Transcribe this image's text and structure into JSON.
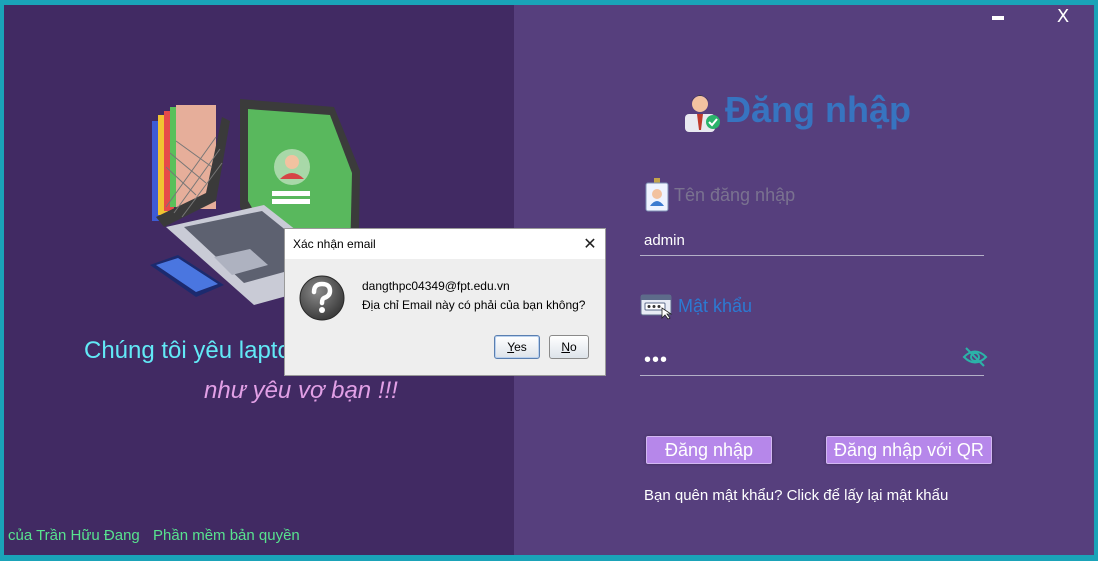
{
  "window": {
    "minimize_label": "",
    "close_label": "X"
  },
  "left": {
    "slogan_line1": "Chúng tôi yêu laptop",
    "slogan_line2": "như yêu vợ bạn !!!",
    "footer_author": "của Trần Hữu Đang",
    "footer_copyright": "Phần mềm bản quyền"
  },
  "login": {
    "title": "Đăng nhập",
    "username_label": "Tên đăng nhập",
    "username_value": "admin",
    "password_label": "Mật khẩu",
    "password_value": "•••",
    "login_button": "Đăng nhập",
    "qr_button": "Đăng nhập với QR",
    "forgot_link": "Bạn quên mật khẩu? Click để lấy lại mật khẩu"
  },
  "dialog": {
    "title": "Xác nhận email",
    "close_label": "✕",
    "email": "dangthpc04349@fpt.edu.vn",
    "question": "Địa chỉ Email này có phải của bạn không?",
    "yes_label": "Yes",
    "no_label": "No"
  },
  "icons": {
    "user_icon": "user-icon",
    "id_badge_icon": "id-badge-icon",
    "password_icon": "password-icon",
    "eye_icon": "eye-slash-icon",
    "question_icon": "question-icon"
  },
  "colors": {
    "left_bg": "#412a63",
    "right_bg": "#563f7d",
    "title_blue": "#3774c0",
    "slogan_cyan": "#62e9f6",
    "slogan_pink": "#e2a0e6",
    "footer_green": "#58e38f",
    "button_purple": "#b687ea"
  }
}
